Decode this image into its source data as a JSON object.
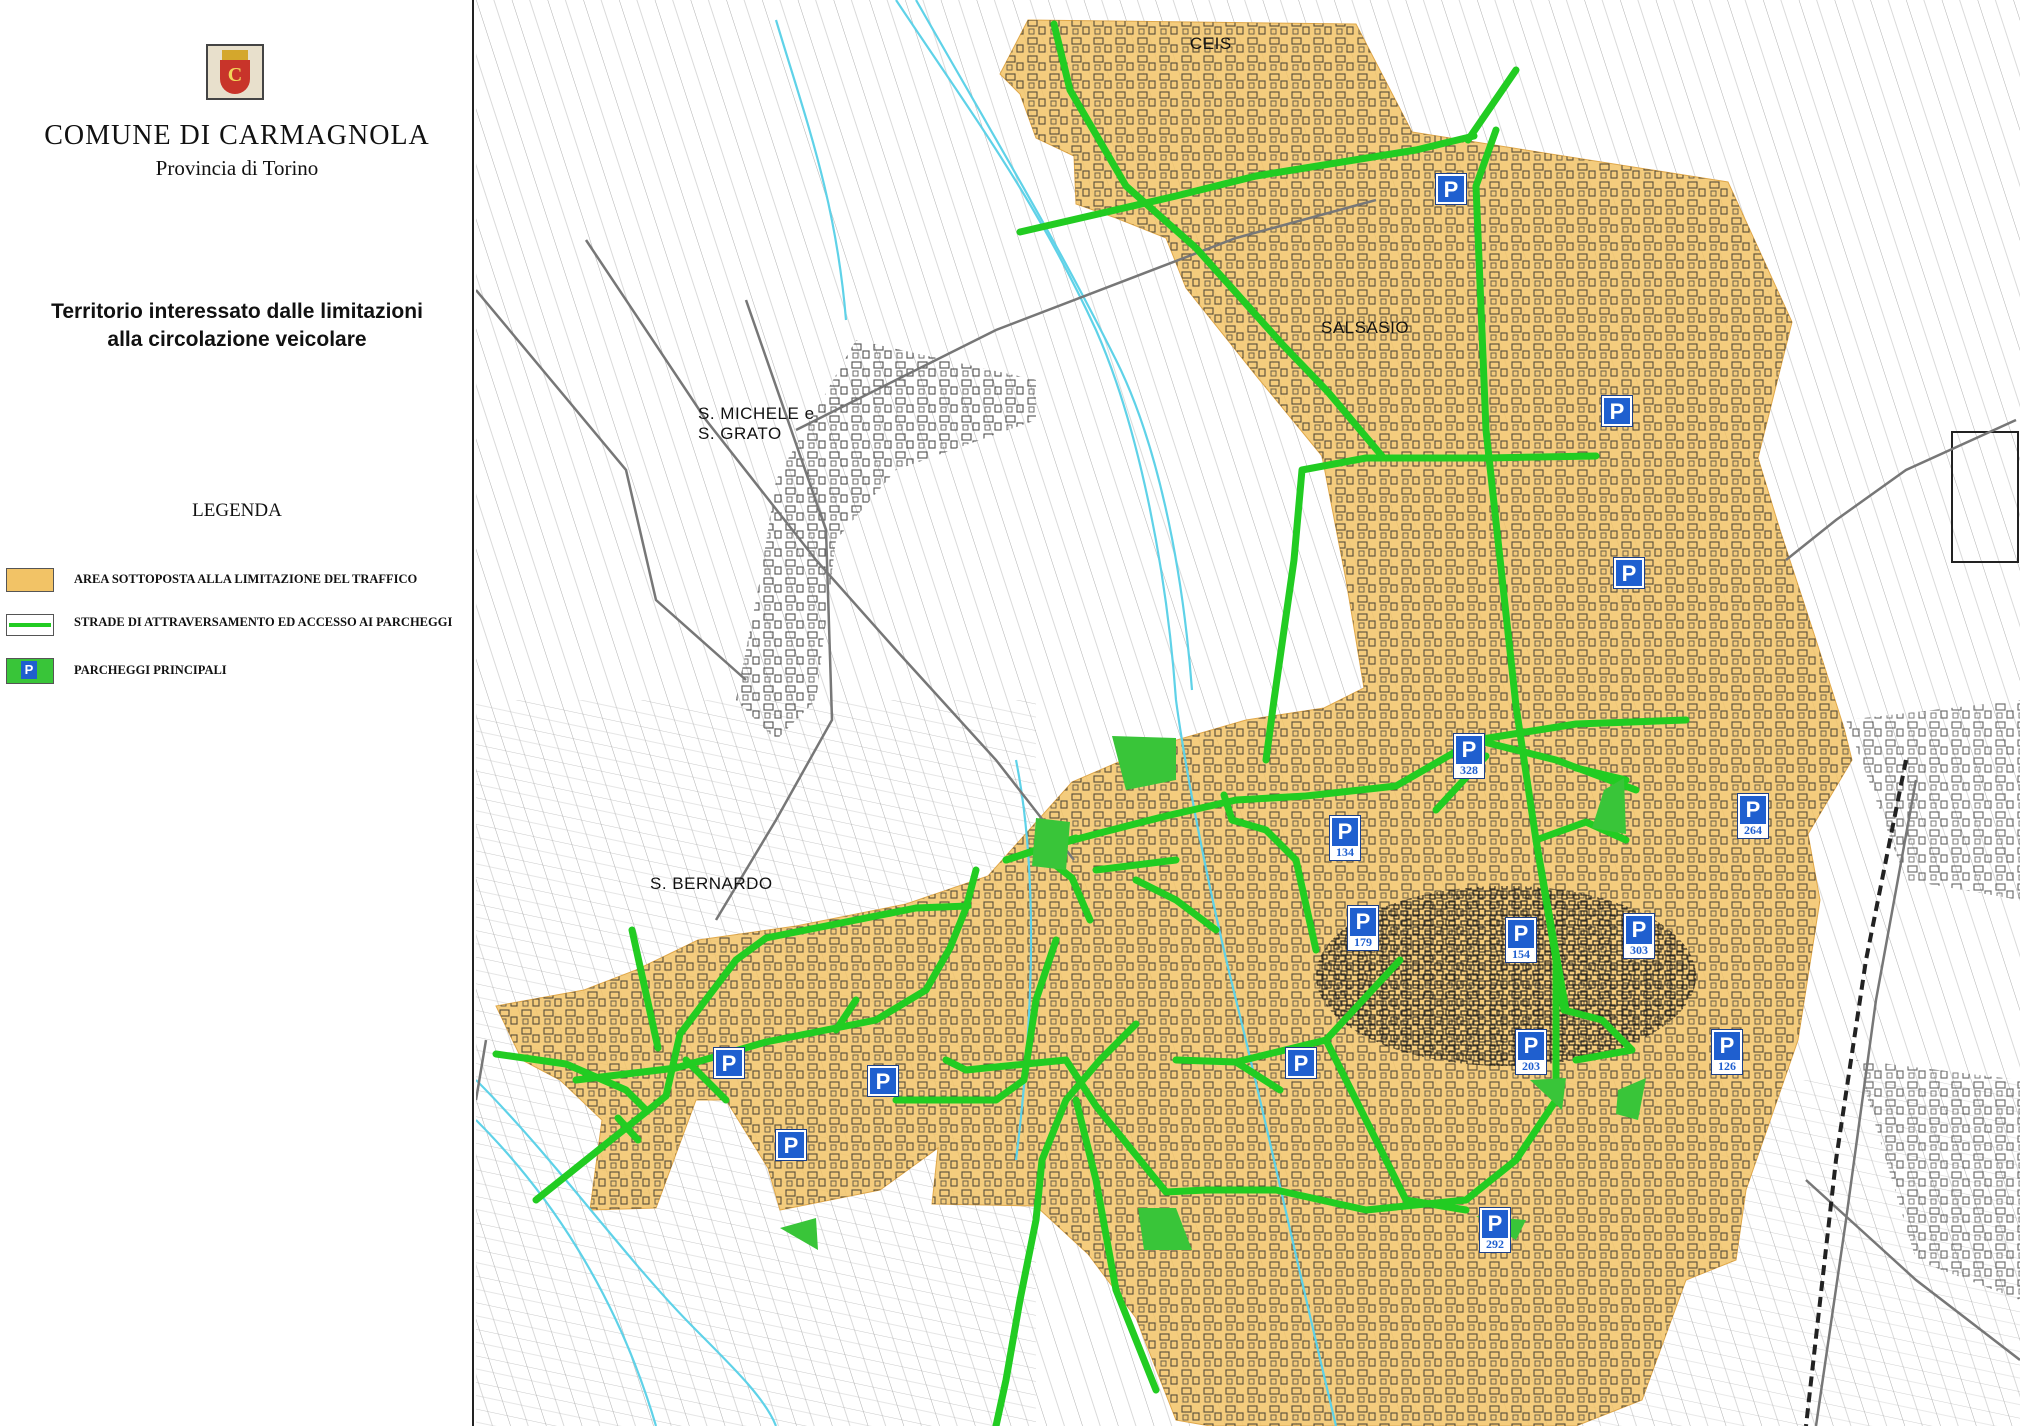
{
  "header": {
    "comune": "COMUNE  DI  CARMAGNOLA",
    "provincia": "Provincia di Torino",
    "heading_line1": "Territorio interessato dalle limitazioni",
    "heading_line2": "alla circolazione veicolare",
    "crest_letter": "C"
  },
  "legend": {
    "title": "LEGENDA",
    "items": [
      {
        "label": "AREA SOTTOPOSTA ALLA LIMITAZIONE DEL TRAFFICO",
        "color": "#f2c366"
      },
      {
        "label": "STRADE DI ATTRAVERSAMENTO ED ACCESSO AI PARCHEGGI",
        "color": "#22cc22"
      },
      {
        "label": "PARCHEGGI PRINCIPALI",
        "icon": "parking-icon",
        "color": "#1f5fcf"
      }
    ]
  },
  "map": {
    "places": [
      {
        "label": "CEIS"
      },
      {
        "label": "SALSASIO"
      },
      {
        "label": "S. MICHELE e\nS. GRATO"
      },
      {
        "label": "S. BERNARDO"
      }
    ],
    "parking_symbol": "P",
    "parkings": [
      {
        "number": ""
      },
      {
        "number": ""
      },
      {
        "number": ""
      },
      {
        "number": "328"
      },
      {
        "number": "264"
      },
      {
        "number": "134"
      },
      {
        "number": "179"
      },
      {
        "number": "154"
      },
      {
        "number": "303"
      },
      {
        "number": "203"
      },
      {
        "number": "126"
      },
      {
        "number": "292"
      },
      {
        "number": ""
      },
      {
        "number": ""
      },
      {
        "number": ""
      }
    ],
    "colors": {
      "area": "#f2c366",
      "roads": "#22cc22",
      "parking": "#1f5fcf",
      "water": "#5fd2e8"
    }
  }
}
